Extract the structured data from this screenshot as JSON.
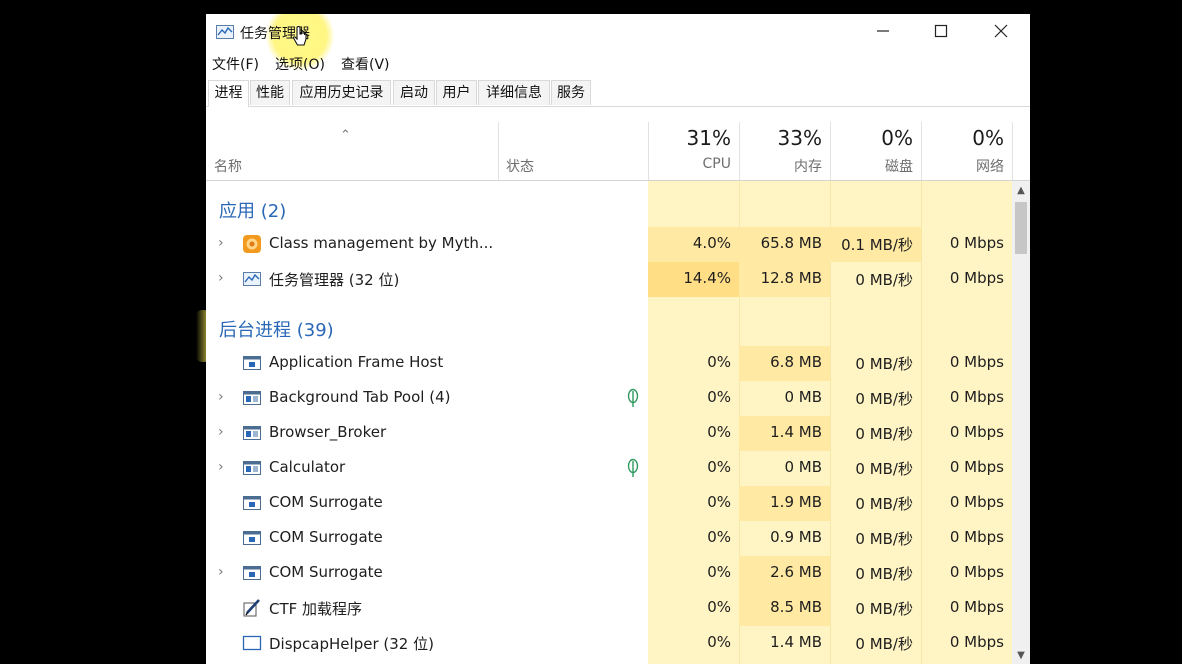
{
  "window": {
    "title": "任务管理器",
    "controls": [
      "minimize",
      "maximize",
      "close"
    ]
  },
  "menu": [
    "文件(F)",
    "选项(O)",
    "查看(V)"
  ],
  "tabs": [
    "进程",
    "性能",
    "应用历史记录",
    "启动",
    "用户",
    "详细信息",
    "服务"
  ],
  "active_tab": "进程",
  "columns": {
    "name": "名称",
    "status": "状态",
    "cpu": {
      "pct": "31%",
      "label": "CPU"
    },
    "memory": {
      "pct": "33%",
      "label": "内存"
    },
    "disk": {
      "pct": "0%",
      "label": "磁盘"
    },
    "network": {
      "pct": "0%",
      "label": "网络"
    }
  },
  "groups": {
    "apps": "应用 (2)",
    "background": "后台进程 (39)"
  },
  "rows": [
    {
      "name": "Class management by Myth...",
      "cpu": "4.0%",
      "memory": "65.8 MB",
      "disk": "0.1 MB/秒",
      "network": "0 Mbps",
      "icon": "orange-app-icon",
      "expandable": true
    },
    {
      "name": "任务管理器 (32 位)",
      "cpu": "14.4%",
      "memory": "12.8 MB",
      "disk": "0 MB/秒",
      "network": "0 Mbps",
      "icon": "task-manager-icon",
      "expandable": true
    },
    {
      "name": "Application Frame Host",
      "cpu": "0%",
      "memory": "6.8 MB",
      "disk": "0 MB/秒",
      "network": "0 Mbps",
      "icon": "process-window-icon",
      "expandable": false
    },
    {
      "name": "Background Tab Pool (4)",
      "cpu": "0%",
      "memory": "0 MB",
      "disk": "0 MB/秒",
      "network": "0 Mbps",
      "icon": "process-window-icon",
      "expandable": true,
      "suspended": true
    },
    {
      "name": "Browser_Broker",
      "cpu": "0%",
      "memory": "1.4 MB",
      "disk": "0 MB/秒",
      "network": "0 Mbps",
      "icon": "process-window-icon",
      "expandable": true
    },
    {
      "name": "Calculator",
      "cpu": "0%",
      "memory": "0 MB",
      "disk": "0 MB/秒",
      "network": "0 Mbps",
      "icon": "process-window-icon",
      "expandable": true,
      "suspended": true
    },
    {
      "name": "COM Surrogate",
      "cpu": "0%",
      "memory": "1.9 MB",
      "disk": "0 MB/秒",
      "network": "0 Mbps",
      "icon": "process-window-icon",
      "expandable": false
    },
    {
      "name": "COM Surrogate",
      "cpu": "0%",
      "memory": "0.9 MB",
      "disk": "0 MB/秒",
      "network": "0 Mbps",
      "icon": "process-window-icon",
      "expandable": false
    },
    {
      "name": "COM Surrogate",
      "cpu": "0%",
      "memory": "2.6 MB",
      "disk": "0 MB/秒",
      "network": "0 Mbps",
      "icon": "process-window-icon",
      "expandable": true
    },
    {
      "name": "CTF 加载程序",
      "cpu": "0%",
      "memory": "8.5 MB",
      "disk": "0 MB/秒",
      "network": "0 Mbps",
      "icon": "pen-edit-icon",
      "expandable": false
    },
    {
      "name": "DispcapHelper (32 位)",
      "cpu": "0%",
      "memory": "1.4 MB",
      "disk": "0 MB/秒",
      "network": "0 Mbps",
      "icon": "blank-window-icon",
      "expandable": false
    }
  ],
  "colors": {
    "group_label": "#2a68b7",
    "heat_light": "#fff4c4",
    "heat_medium": "#ffe9a3",
    "heat_strong": "#ffde85"
  }
}
